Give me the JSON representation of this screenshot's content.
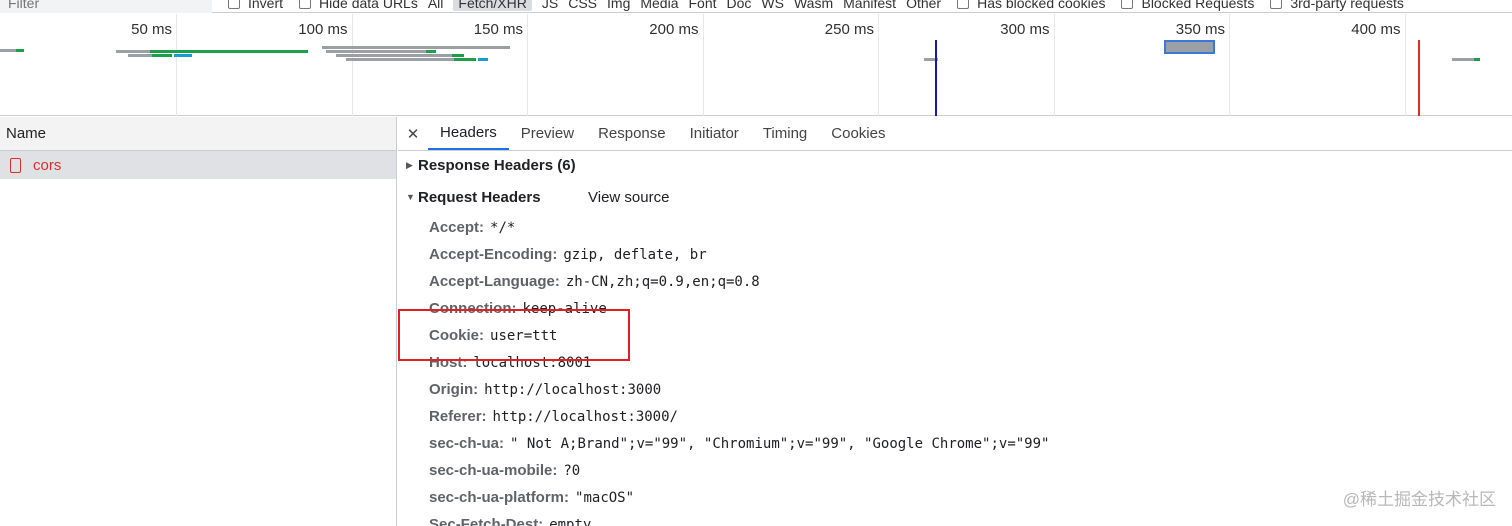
{
  "filter_bar": {
    "placeholder": "Filter",
    "invert_label": "Invert",
    "hide_data_urls_label": "Hide data URLs",
    "types": [
      "All",
      "Fetch/XHR",
      "JS",
      "CSS",
      "Img",
      "Media",
      "Font",
      "Doc",
      "WS",
      "Wasm",
      "Manifest",
      "Other"
    ],
    "active_type": "Fetch/XHR",
    "blocked_cookies_label": "Has blocked cookies",
    "blocked_requests_label": "Blocked Requests",
    "third_party_label": "3rd-party requests"
  },
  "overview": {
    "tick_labels": [
      "50 ms",
      "100 ms",
      "150 ms",
      "200 ms",
      "250 ms",
      "300 ms",
      "350 ms",
      "400 ms"
    ],
    "dom_content_loaded_color": "#1a1aa6",
    "load_color": "#d93025"
  },
  "request_list": {
    "column_name": "Name",
    "requests": [
      {
        "name": "cors",
        "status_color": "#d93025"
      }
    ]
  },
  "detail": {
    "tabs": [
      "Headers",
      "Preview",
      "Response",
      "Initiator",
      "Timing",
      "Cookies"
    ],
    "active_tab": "Headers",
    "response_headers_title": "Response Headers (6)",
    "request_headers_title": "Request Headers",
    "view_source_label": "View source",
    "request_headers": [
      {
        "name": "Accept:",
        "value": "*/*"
      },
      {
        "name": "Accept-Encoding:",
        "value": "gzip, deflate, br"
      },
      {
        "name": "Accept-Language:",
        "value": "zh-CN,zh;q=0.9,en;q=0.8"
      },
      {
        "name": "Connection:",
        "value": "keep-alive"
      },
      {
        "name": "Cookie:",
        "value": "user=ttt"
      },
      {
        "name": "Host:",
        "value": "localhost:8001"
      },
      {
        "name": "Origin:",
        "value": "http://localhost:3000"
      },
      {
        "name": "Referer:",
        "value": "http://localhost:3000/"
      },
      {
        "name": "sec-ch-ua:",
        "value": "\" Not A;Brand\";v=\"99\", \"Chromium\";v=\"99\", \"Google Chrome\";v=\"99\""
      },
      {
        "name": "sec-ch-ua-mobile:",
        "value": "?0"
      },
      {
        "name": "sec-ch-ua-platform:",
        "value": "\"macOS\""
      },
      {
        "name": "Sec-Fetch-Dest:",
        "value": "empty"
      }
    ],
    "highlight_color": "#e02027"
  },
  "watermark": "@稀土掘金技术社区"
}
